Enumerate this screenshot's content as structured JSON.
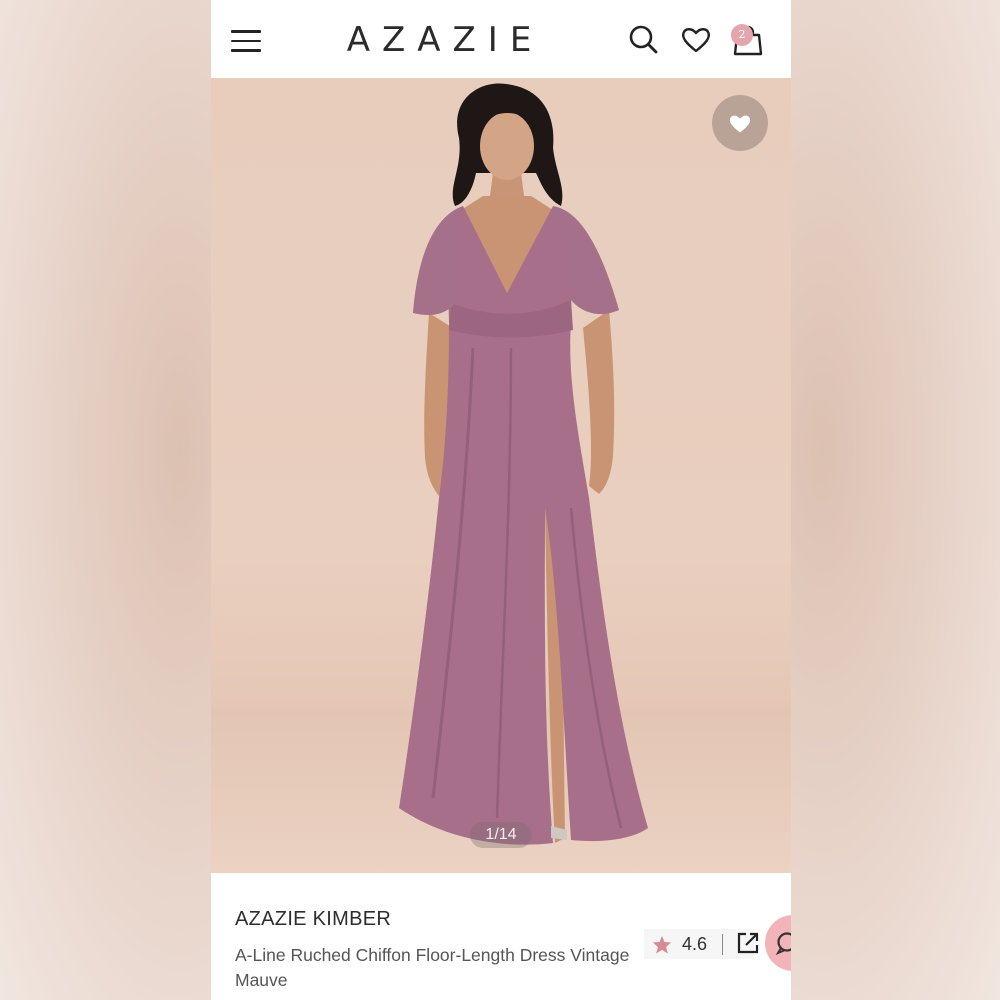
{
  "header": {
    "logo": "AZAZIE",
    "cart_count": "2"
  },
  "gallery": {
    "pager": "1/14"
  },
  "product": {
    "name": "AZAZIE KIMBER",
    "description": "A-Line Ruched Chiffon Floor-Length Dress Vintage Mauve",
    "rating": "4.6"
  },
  "colors": {
    "dress": "#a86f8a",
    "badge": "#e4a5ad",
    "star": "#d98a99",
    "chat": "#f2b4b9"
  }
}
